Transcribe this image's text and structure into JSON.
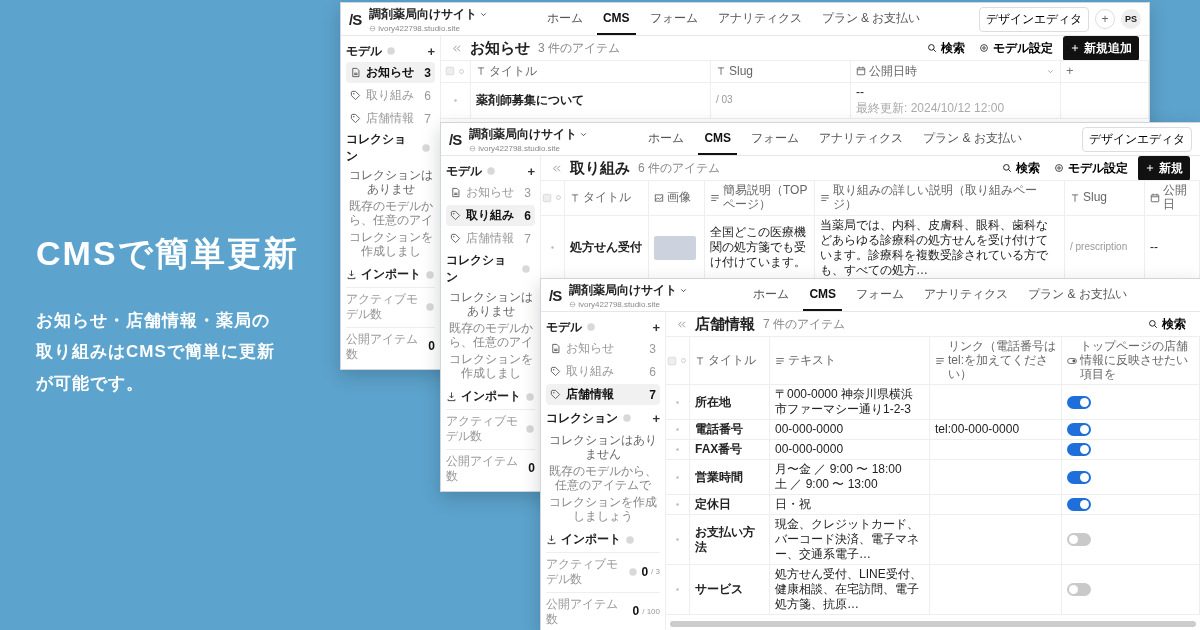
{
  "headline": "CMSで簡単更新",
  "description": "お知らせ・店舗情報・薬局の取り組みはCMSで簡単に更新が可能です。",
  "windows": [
    {
      "header": {
        "logo": "/S",
        "site_name": "調剤薬局向けサイト",
        "site_url": "ivory422798.studio.site",
        "nav": [
          {
            "label": "ホーム",
            "selected": false
          },
          {
            "label": "CMS",
            "selected": true
          },
          {
            "label": "フォーム",
            "selected": false
          },
          {
            "label": "アナリティクス",
            "selected": false
          },
          {
            "label": "プラン & お支払い",
            "selected": false
          }
        ],
        "editor_button": "デザインエディタ",
        "add_button": "+",
        "avatar": "PS"
      },
      "sidebar": {
        "models_label": "モデル",
        "models_add": "+",
        "models": [
          {
            "label": "お知らせ",
            "count": "3",
            "kind": "document",
            "selected": true
          },
          {
            "label": "取り組み",
            "count": "6",
            "kind": "tag",
            "selected": false
          },
          {
            "label": "店舗情報",
            "count": "7",
            "kind": "tag",
            "selected": false
          }
        ],
        "collections_label": "コレクション",
        "collection_lines": [
          "コレクションはありませ",
          "既存のモデルから、任意のアイ",
          "コレクションを作成しまし"
        ],
        "import_label": "インポート",
        "stats": [
          {
            "label": "アクティブモデル数"
          },
          {
            "label": "公開アイテム数",
            "value": "0"
          }
        ]
      },
      "main": {
        "title": "お知らせ",
        "count": "3 件のアイテム",
        "actions": [
          {
            "label": "検索",
            "kind": "search"
          },
          {
            "label": "モデル設定",
            "kind": "settings"
          },
          {
            "label": "新規追加",
            "kind": "add"
          }
        ],
        "columns": [
          {
            "label": "タイトル",
            "kind": "text"
          },
          {
            "label": "Slug",
            "kind": "text"
          },
          {
            "label": "公開日時",
            "kind": "date"
          }
        ],
        "add_column": "+",
        "rows": [
          {
            "cells": [
              {
                "text": "薬剤師募集について"
              },
              {
                "text": "/ 03"
              },
              {
                "text": "--",
                "note": "最終更新: 2024/10/12 12:00"
              }
            ]
          }
        ]
      }
    },
    {
      "header": {
        "logo": "/S",
        "site_name": "調剤薬局向けサイト",
        "site_url": "ivory422798.studio.site",
        "nav": [
          {
            "label": "ホーム",
            "selected": false
          },
          {
            "label": "CMS",
            "selected": true
          },
          {
            "label": "フォーム",
            "selected": false
          },
          {
            "label": "アナリティクス",
            "selected": false
          },
          {
            "label": "プラン & お支払い",
            "selected": false
          }
        ],
        "editor_button": "デザインエディタ"
      },
      "sidebar": {
        "models_label": "モデル",
        "models_add": "+",
        "models": [
          {
            "label": "お知らせ",
            "count": "3",
            "kind": "document",
            "selected": false
          },
          {
            "label": "取り組み",
            "count": "6",
            "kind": "tag",
            "selected": true
          },
          {
            "label": "店舗情報",
            "count": "7",
            "kind": "tag",
            "selected": false
          }
        ],
        "collections_label": "コレクション",
        "collection_lines": [
          "コレクションはありませ",
          "既存のモデルから、任意のアイ",
          "コレクションを作成しまし"
        ],
        "import_label": "インポート",
        "stats": [
          {
            "label": "アクティブモデル数"
          },
          {
            "label": "公開アイテム数",
            "value": "0"
          }
        ]
      },
      "main": {
        "title": "取り組み",
        "count": "6 件のアイテム",
        "actions": [
          {
            "label": "検索",
            "kind": "search"
          },
          {
            "label": "モデル設定",
            "kind": "settings"
          },
          {
            "label": "新規",
            "kind": "add"
          }
        ],
        "columns": [
          {
            "label": "タイトル",
            "kind": "text"
          },
          {
            "label": "画像",
            "kind": "image"
          },
          {
            "label": "簡易説明（TOPページ）",
            "kind": "richtext"
          },
          {
            "label": "取り組みの詳しい説明（取り組みページ）",
            "kind": "richtext"
          },
          {
            "label": "Slug",
            "kind": "text"
          },
          {
            "label": "公開日",
            "kind": "date"
          }
        ],
        "rows": [
          {
            "cells": [
              {
                "text": "処方せん受付"
              },
              {
                "image": true
              },
              {
                "text": "全国どこの医療機関の処方箋でも受け付けています。"
              },
              {
                "text": "当薬局では、内科、皮膚科、眼科、歯科などあらゆる診療科の処方せんを受け付けています。診療科を複数受診されている方でも、すべての処方…"
              },
              {
                "text": "/ prescription"
              },
              {
                "text": "--"
              }
            ]
          }
        ]
      }
    },
    {
      "header": {
        "logo": "/S",
        "site_name": "調剤薬局向けサイト",
        "site_url": "ivory422798.studio.site",
        "nav": [
          {
            "label": "ホーム",
            "selected": false
          },
          {
            "label": "CMS",
            "selected": true
          },
          {
            "label": "フォーム",
            "selected": false
          },
          {
            "label": "アナリティクス",
            "selected": false
          },
          {
            "label": "プラン & お支払い",
            "selected": false
          }
        ]
      },
      "sidebar": {
        "models_label": "モデル",
        "models_add": "+",
        "models": [
          {
            "label": "お知らせ",
            "count": "3",
            "kind": "document",
            "selected": false
          },
          {
            "label": "取り組み",
            "count": "6",
            "kind": "tag",
            "selected": false
          },
          {
            "label": "店舗情報",
            "count": "7",
            "kind": "tag",
            "selected": true
          }
        ],
        "collections_label": "コレクション",
        "collections_add": "+",
        "collection_lines": [
          "コレクションはありません",
          "既存のモデルから、任意のアイテムで",
          "コレクションを作成しましょう"
        ],
        "import_label": "インポート",
        "stats": [
          {
            "label": "アクティブモデル数",
            "value": "0",
            "total": "/ 3"
          },
          {
            "label": "公開アイテム数",
            "value": "0",
            "total": "/ 100"
          }
        ]
      },
      "main": {
        "title": "店舗情報",
        "count": "7 件のアイテム",
        "actions": [
          {
            "label": "検索",
            "kind": "search"
          }
        ],
        "columns": [
          {
            "label": "タイトル",
            "kind": "text"
          },
          {
            "label": "テキスト",
            "kind": "richtext"
          },
          {
            "label": "リンク（電話番号はtel:を加えてください）",
            "kind": "richtext"
          },
          {
            "label": "トップページの店舗情報に反映させたい項目を",
            "kind": "boolean"
          }
        ],
        "rows": [
          {
            "cells": [
              {
                "text": "所在地"
              },
              {
                "text": "〒000-0000 神奈川県横浜市ファーマシー通り1-2-3"
              },
              {},
              {
                "on": true
              }
            ]
          },
          {
            "cells": [
              {
                "text": "電話番号"
              },
              {
                "text": "00-000-0000"
              },
              {
                "text": "tel:00-000-0000"
              },
              {
                "on": true
              }
            ]
          },
          {
            "cells": [
              {
                "text": "FAX番号"
              },
              {
                "text": "00-000-0000"
              },
              {},
              {
                "on": true
              }
            ]
          },
          {
            "cells": [
              {
                "text": "営業時間"
              },
              {
                "text": "月〜金 ／ 9:00 〜 18:00\n土 ／ 9:00 〜 13:00"
              },
              {},
              {
                "on": true
              }
            ]
          },
          {
            "cells": [
              {
                "text": "定休日"
              },
              {
                "text": "日・祝"
              },
              {},
              {
                "on": true
              }
            ]
          },
          {
            "cells": [
              {
                "text": "お支払い方法"
              },
              {
                "text": "現金、クレジットカード、バーコード決済、電子マネー、交通系電子…"
              },
              {},
              {
                "on": false
              }
            ]
          },
          {
            "cells": [
              {
                "text": "サービス"
              },
              {
                "text": "処方せん受付、LINE受付、健康相談、在宅訪問、電子処方箋、抗原…"
              },
              {},
              {
                "on": false
              }
            ]
          }
        ]
      }
    }
  ]
}
